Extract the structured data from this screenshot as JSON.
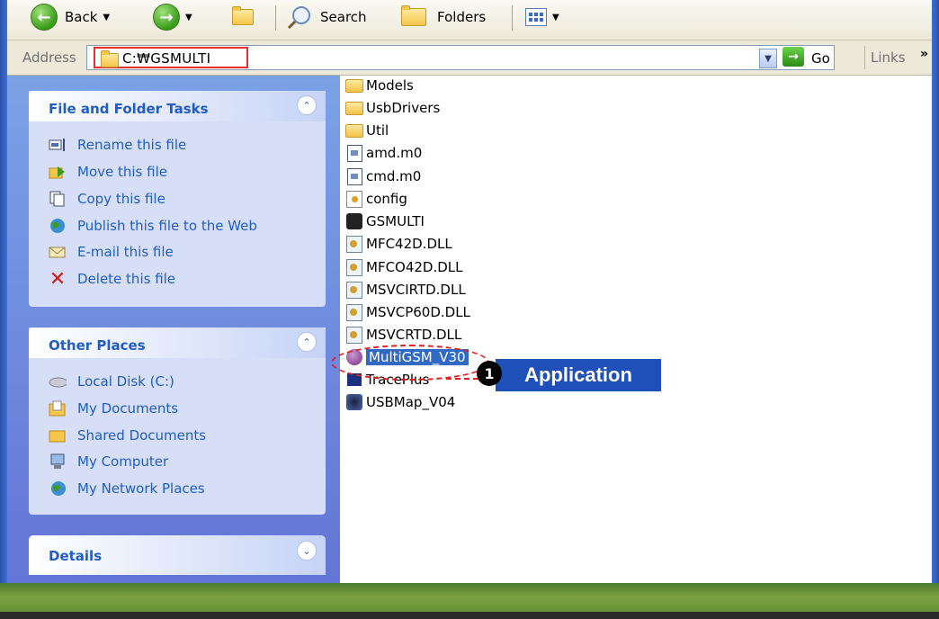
{
  "toolbar": {
    "back": "Back",
    "search": "Search",
    "folders": "Folders"
  },
  "address": {
    "label": "Address",
    "value": "C:₩GSMULTI",
    "go": "Go",
    "links": "Links"
  },
  "tasks": {
    "title": "File and Folder Tasks",
    "items": [
      {
        "label": "Rename this file",
        "icon": "rename-icon"
      },
      {
        "label": "Move this file",
        "icon": "move-icon"
      },
      {
        "label": "Copy this file",
        "icon": "copy-icon"
      },
      {
        "label": "Publish this file to the Web",
        "icon": "globe-icon"
      },
      {
        "label": "E-mail this file",
        "icon": "email-icon"
      },
      {
        "label": "Delete this file",
        "icon": "delete-icon"
      }
    ]
  },
  "places": {
    "title": "Other Places",
    "items": [
      {
        "label": "Local Disk (C:)",
        "icon": "disk-icon"
      },
      {
        "label": "My Documents",
        "icon": "documents-icon"
      },
      {
        "label": "Shared Documents",
        "icon": "folder-icon"
      },
      {
        "label": "My Computer",
        "icon": "computer-icon"
      },
      {
        "label": "My Network Places",
        "icon": "network-icon"
      }
    ]
  },
  "details": {
    "title": "Details"
  },
  "files": [
    {
      "name": "Models",
      "type": "folder"
    },
    {
      "name": "UsbDrivers",
      "type": "folder"
    },
    {
      "name": "Util",
      "type": "folder"
    },
    {
      "name": "amd.m0",
      "type": "doc"
    },
    {
      "name": "cmd.m0",
      "type": "doc"
    },
    {
      "name": "config",
      "type": "config"
    },
    {
      "name": "GSMULTI",
      "type": "gsmulti"
    },
    {
      "name": "MFC42D.DLL",
      "type": "dll"
    },
    {
      "name": "MFCO42D.DLL",
      "type": "dll"
    },
    {
      "name": "MSVCIRTD.DLL",
      "type": "dll"
    },
    {
      "name": "MSVCP60D.DLL",
      "type": "dll"
    },
    {
      "name": "MSVCRTD.DLL",
      "type": "dll"
    },
    {
      "name": "MultiGSM_V30",
      "type": "app",
      "selected": true
    },
    {
      "name": "TracePlus",
      "type": "trace"
    },
    {
      "name": "USBMap_V04",
      "type": "usb"
    }
  ],
  "callout": {
    "number": "1",
    "label": "Application",
    "color": "#1f4fb8"
  }
}
